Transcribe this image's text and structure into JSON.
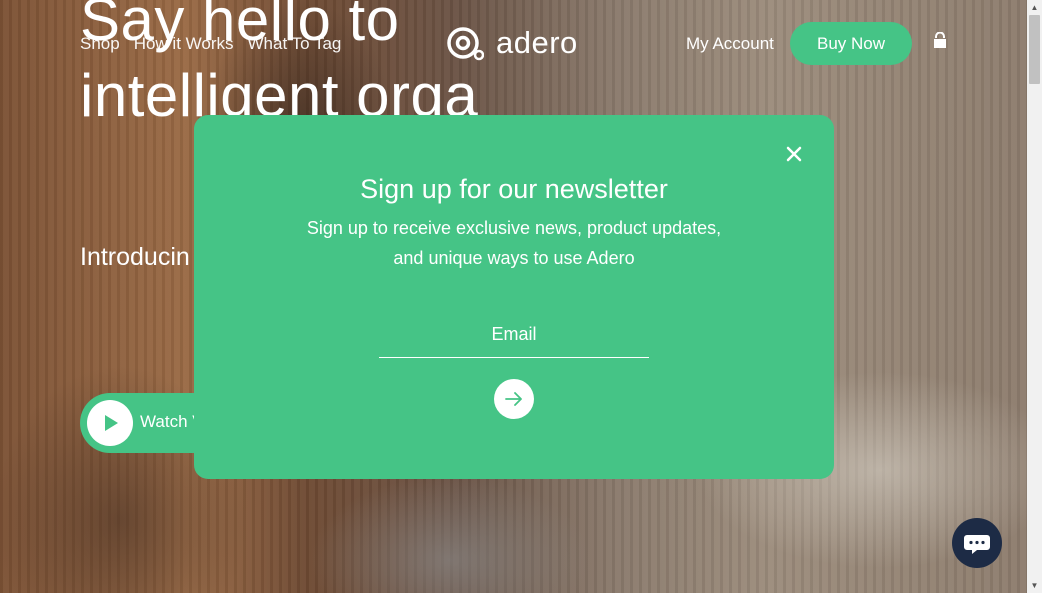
{
  "nav": {
    "links": [
      "Shop",
      "How it Works",
      "What To Tag"
    ],
    "logo_text": "adero",
    "my_account": "My Account",
    "buy_now": "Buy Now"
  },
  "hero": {
    "headline": "Say hello to intelligent orga",
    "intro": "Introducin your thing stress, and",
    "watch_label": "Watch V"
  },
  "modal": {
    "title": "Sign up for our newsletter",
    "subtitle": "Sign up to receive exclusive news, product updates, and unique ways to use Adero",
    "email_placeholder": "Email"
  },
  "colors": {
    "accent": "#45c486",
    "chat": "#1d2b45"
  },
  "icons": [
    "play-icon",
    "logo-icon",
    "cart-icon",
    "close-icon",
    "arrow-right-icon",
    "chat-icon"
  ]
}
